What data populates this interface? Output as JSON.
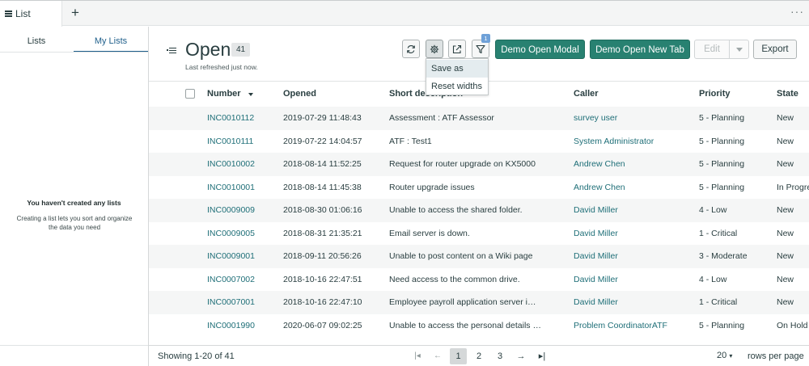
{
  "tabs": {
    "active_label": "List",
    "add_label": "+",
    "more_label": "···"
  },
  "sidebar": {
    "tabs": [
      {
        "label": "Lists"
      },
      {
        "label": "My Lists"
      }
    ],
    "empty_title": "You haven't created any lists",
    "empty_text": "Creating a list lets you sort and organize the data you need"
  },
  "header": {
    "title": "Open",
    "count": "41",
    "refreshed": "Last refreshed just now.",
    "filter_badge": "1",
    "buttons": {
      "modal": "Demo Open Modal",
      "newtab": "Demo Open New Tab",
      "edit": "Edit",
      "export": "Export"
    },
    "icons": [
      "refresh-icon",
      "gear-icon",
      "share-icon",
      "filter-icon"
    ]
  },
  "menu": {
    "items": [
      "Save as",
      "Reset widths"
    ]
  },
  "table": {
    "columns": [
      "Number",
      "Opened",
      "Short description",
      "Caller",
      "Priority",
      "State"
    ],
    "rows": [
      {
        "number": "INC0010112",
        "opened": "2019-07-29 11:48:43",
        "desc": "Assessment : ATF Assessor",
        "caller": "survey user",
        "priority": "5 - Planning",
        "state": "New"
      },
      {
        "number": "INC0010111",
        "opened": "2019-07-22 14:04:57",
        "desc": "ATF : Test1",
        "caller": "System Administrator",
        "priority": "5 - Planning",
        "state": "New"
      },
      {
        "number": "INC0010002",
        "opened": "2018-08-14 11:52:25",
        "desc": "Request for router upgrade on KX5000",
        "caller": "Andrew Chen",
        "priority": "5 - Planning",
        "state": "New"
      },
      {
        "number": "INC0010001",
        "opened": "2018-08-14 11:45:38",
        "desc": "Router upgrade issues",
        "caller": "Andrew Chen",
        "priority": "5 - Planning",
        "state": "In Progre"
      },
      {
        "number": "INC0009009",
        "opened": "2018-08-30 01:06:16",
        "desc": "Unable to access the shared folder.",
        "caller": "David Miller",
        "priority": "4 - Low",
        "state": "New"
      },
      {
        "number": "INC0009005",
        "opened": "2018-08-31 21:35:21",
        "desc": "Email server is down.",
        "caller": "David Miller",
        "priority": "1 - Critical",
        "state": "New"
      },
      {
        "number": "INC0009001",
        "opened": "2018-09-11 20:56:26",
        "desc": "Unable to post content on a Wiki page",
        "caller": "David Miller",
        "priority": "3 - Moderate",
        "state": "New"
      },
      {
        "number": "INC0007002",
        "opened": "2018-10-16 22:47:51",
        "desc": "Need access to the common drive.",
        "caller": "David Miller",
        "priority": "4 - Low",
        "state": "New"
      },
      {
        "number": "INC0007001",
        "opened": "2018-10-16 22:47:10",
        "desc": "Employee payroll application server i…",
        "caller": "David Miller",
        "priority": "1 - Critical",
        "state": "New"
      },
      {
        "number": "INC0001990",
        "opened": "2020-06-07 09:02:25",
        "desc": "Unable to access the personal details …",
        "caller": "Problem CoordinatorATF",
        "priority": "5 - Planning",
        "state": "On Hold"
      }
    ]
  },
  "footer": {
    "showing": "Showing 1-20 of 41",
    "pages": [
      "1",
      "2",
      "3"
    ],
    "current_page": "1",
    "per_page": "20",
    "rows_per_page_label": "rows per page"
  },
  "colors": {
    "accent_green": "#288171",
    "link": "#1f6f78",
    "filter_badge": "#6fa1d8"
  }
}
